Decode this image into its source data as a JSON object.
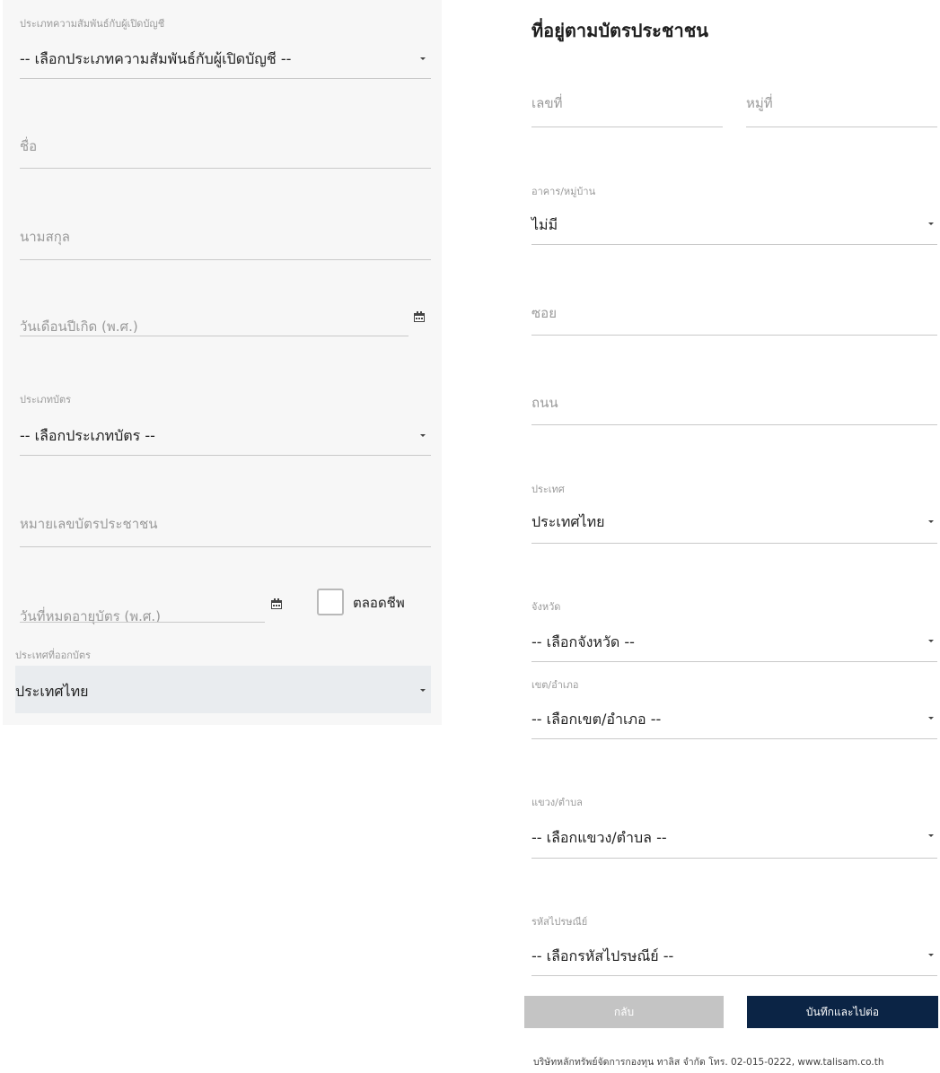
{
  "left_form": {
    "relationship": {
      "label": "ประเภทความสัมพันธ์กับผู้เปิดบัญชี",
      "value": "-- เลือกประเภทความสัมพันธ์กับผู้เปิดบัญชี --"
    },
    "first_name": {
      "placeholder": "ชื่อ"
    },
    "last_name": {
      "placeholder": "นามสกุล"
    },
    "birth_date": {
      "placeholder": "วันเดือนปีเกิด (พ.ศ.)"
    },
    "card_type": {
      "label": "ประเภทบัตร",
      "value": "-- เลือกประเภทบัตร --"
    },
    "id_number": {
      "placeholder": "หมายเลขบัตรประชาชน"
    },
    "expiry_date": {
      "placeholder": "วันที่หมดอายุบัตร (พ.ศ.)"
    },
    "lifetime": {
      "label": "ตลอดชีพ",
      "checked": false
    },
    "issuing_country": {
      "label": "ประเทศที่ออกบัตร",
      "value": "ประเทศไทย"
    }
  },
  "right_form": {
    "title": "ที่อยู่ตามบัตรประชาชน",
    "house_no": {
      "placeholder": "เลขที่"
    },
    "moo": {
      "placeholder": "หมู่ที่"
    },
    "building": {
      "label": "อาคาร/หมู่บ้าน",
      "value": "ไม่มี"
    },
    "soi": {
      "placeholder": "ซอย"
    },
    "road": {
      "placeholder": "ถนน"
    },
    "country": {
      "label": "ประเทศ",
      "value": "ประเทศไทย"
    },
    "province": {
      "label": "จังหวัด",
      "value": "-- เลือกจังหวัด --"
    },
    "district": {
      "label": "เขต/อำเภอ",
      "value": "-- เลือกเขต/อำเภอ --"
    },
    "subdistrict": {
      "label": "แขวง/ตำบล",
      "value": "-- เลือกแขวง/ตำบล --"
    },
    "postcode": {
      "label": "รหัสไปรษณีย์",
      "value": "-- เลือกรหัสไปรษณีย์ --"
    }
  },
  "buttons": {
    "back": "กลับ",
    "save_next": "บันทึกและไปต่อ"
  },
  "footer": "บริษัทหลักทรัพย์จัดการกองทุน ทาลิส จำกัด โทร. 02-015-0222, www.talisam.co.th",
  "colors": {
    "primary_button": "#0b2445",
    "secondary_button": "#c4c4c4",
    "panel_background": "#f7f7f7",
    "filled_select": "#e9ecef"
  }
}
